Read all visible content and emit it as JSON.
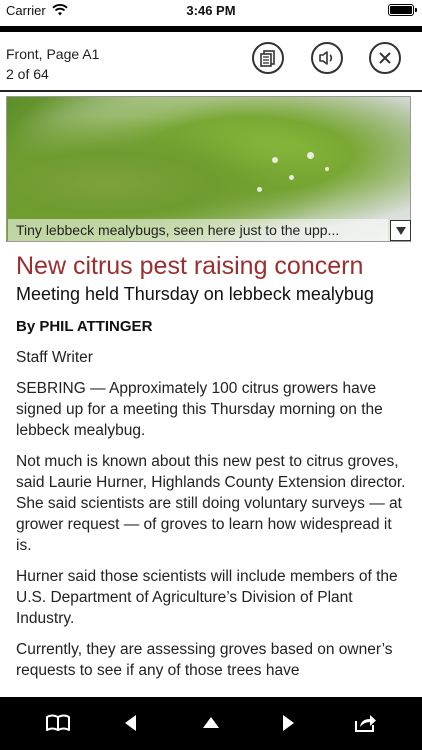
{
  "status_bar": {
    "carrier": "Carrier",
    "time": "3:46 PM"
  },
  "header": {
    "section": "Front, Page A1",
    "page_counter": "2 of 64"
  },
  "toolbar_icons": [
    "text-view-icon",
    "speaker-icon",
    "close-icon"
  ],
  "photo": {
    "caption": "Tiny lebbeck mealybugs, seen here just to the upp..."
  },
  "article": {
    "headline": "New citrus pest raising concern",
    "subhead": "Meeting held Thursday on lebbeck mealybug",
    "byline": "By PHIL ATTINGER",
    "role": "Staff Writer",
    "paragraphs": [
      "SEBRING — Approximately 100 citrus growers have signed up for a meeting this Thursday morning on the lebbeck mealybug.",
      "Not much is known about this new pest to citrus groves, said Laurie Hurner, Highlands County Extension director. She said scientists are still doing voluntary surveys — at grower request — of groves to learn how widespread it is.",
      "Hurner said those scientists will include members of the U.S. Department of Agriculture’s Division of Plant Industry.",
      "Currently, they are assessing groves based on owner’s requests to see if any of those trees have"
    ]
  },
  "bottom_bar_icons": [
    "book-icon",
    "previous-icon",
    "up-icon",
    "next-icon",
    "share-icon"
  ],
  "colors": {
    "headline": "#9b2e2e",
    "bars": "#000000"
  }
}
